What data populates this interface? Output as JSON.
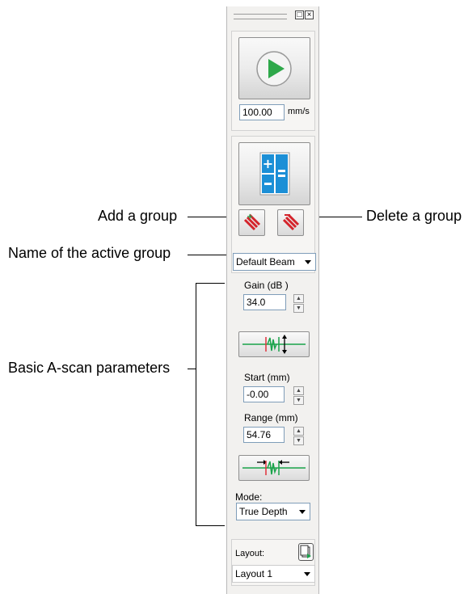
{
  "panel": {
    "speed": {
      "value": "100.00",
      "unit": "mm/s"
    },
    "group_selector": {
      "value": "Default Beam"
    },
    "gain": {
      "label": "Gain (dB )",
      "value": "34.0"
    },
    "start": {
      "label": "Start  (mm)",
      "value": "-0.00"
    },
    "range": {
      "label": "Range   (mm)",
      "value": "54.76"
    },
    "mode": {
      "label": "Mode:",
      "value": "True Depth"
    },
    "layout": {
      "label": "Layout:",
      "value": "Layout 1"
    }
  },
  "callouts": {
    "add_group": "Add a group",
    "delete_group": "Delete a group",
    "active_group_name": "Name of the active group",
    "basic_ascan": "Basic A-scan parameters"
  },
  "colors": {
    "play_green": "#2ea84a",
    "group_blue": "#1c8fd6",
    "wave_green": "#19a34a",
    "wave_red": "#e0303a"
  }
}
